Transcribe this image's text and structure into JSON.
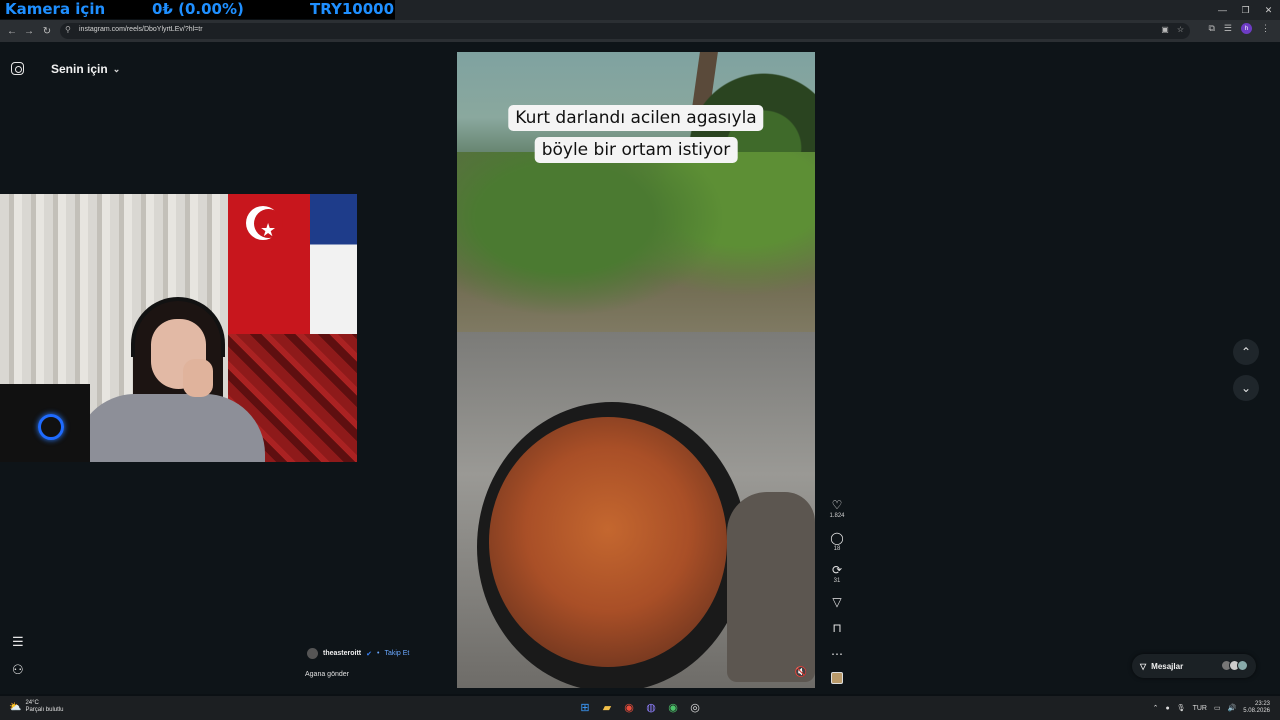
{
  "overlay": {
    "left_text": "Kamera için",
    "middle_text": "0₺ (0.00%)",
    "right_text": "TRY10000"
  },
  "browser": {
    "url": "instagram.com/reels/DboYlyrtLEv/?hl=tr",
    "profile_initial": "h",
    "icons": [
      "back-icon",
      "forward-icon",
      "reload-icon",
      "site-info-icon",
      "install-icon",
      "star-icon",
      "extensions-icon",
      "media-icon",
      "profile-icon",
      "menu-icon"
    ],
    "window_controls": [
      "minimize",
      "restore",
      "close"
    ]
  },
  "instagram": {
    "feed_title": "Senin için",
    "reel": {
      "caption_line1": "Kurt darlandı acilen agasıyla",
      "caption_line2": "böyle bir ortam istiyor",
      "author": "theasteroitt",
      "follow_label": "Takip Et",
      "follow_separator": "•",
      "description": "Agana gönder"
    },
    "actions": {
      "likes": "1.824",
      "comments": "18",
      "reposts": "31"
    },
    "messages_label": "Mesajlar"
  },
  "taskbar": {
    "temperature": "24°C",
    "weather_desc": "Parçalı bulutlu",
    "language": "TUR",
    "time": "23:23",
    "date": "5.08.2026"
  }
}
